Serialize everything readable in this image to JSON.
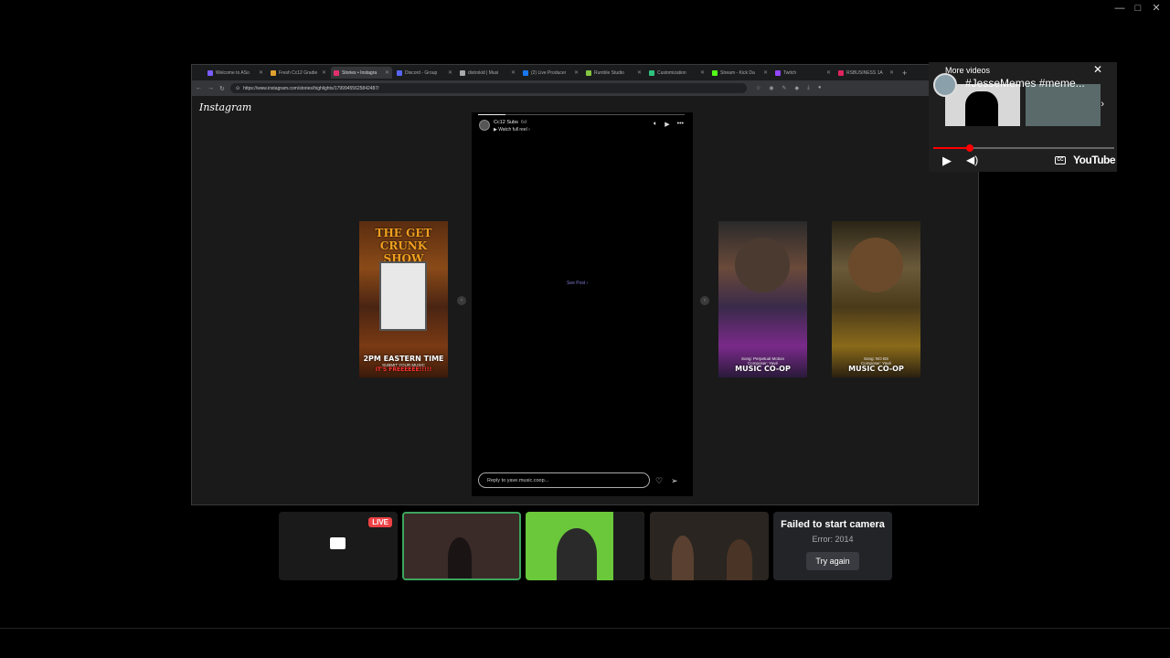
{
  "window_controls": [
    "—",
    "□",
    "✕"
  ],
  "browser": {
    "tabs": [
      {
        "label": "Welcome to ASo",
        "color": "#7b5cff"
      },
      {
        "label": "Fresh Cc12 Gradie",
        "color": "#e0a030"
      },
      {
        "label": "Stories • Instagra",
        "color": "#e1306c"
      },
      {
        "label": "Discord - Group",
        "color": "#5865f2"
      },
      {
        "label": "distrokid | Musi",
        "color": "#aaaaaa"
      },
      {
        "label": "(2) Live Producer",
        "color": "#1877f2"
      },
      {
        "label": "Rumble Studio",
        "color": "#85c742"
      },
      {
        "label": "Customization",
        "color": "#2ec27e"
      },
      {
        "label": "Stream - Kick Da",
        "color": "#53fc18"
      },
      {
        "label": "Twitch",
        "color": "#9146ff"
      },
      {
        "label": "RSBUSINESS 1A",
        "color": "#e0245e"
      }
    ],
    "url": "https://www.instagram.com/stories/highlights/17999455625842487/"
  },
  "instagram": {
    "logo": "Instagram",
    "story": {
      "username": "Cc12 Subs",
      "time": "6d",
      "watch_full": "Watch full reel",
      "see_post": "See Post",
      "reply_placeholder": "Reply to yave.music.coop..."
    },
    "thumbs": [
      {
        "top": "THE GET CRUNK SHOW",
        "big": "2PM EASTERN TIME",
        "sub": "SUBMIT YOUR MUSIC",
        "foot": "IT'S FREEEEEE!!!!!"
      },
      {
        "top": "",
        "big": "MUSIC CO-OP",
        "sub": "Song: Perpetual Motion",
        "foot": "Composer: Yavé"
      },
      {
        "top": "",
        "big": "MUSIC CO-OP",
        "sub": "Song: NO BS",
        "foot": "Composer: Yavé"
      }
    ]
  },
  "youtube": {
    "more_videos": "More videos",
    "video_title": "#JesseMemes #meme...",
    "logo": "YouTube",
    "progress_fraction": 0.2
  },
  "participants": {
    "live_label": "LIVE",
    "failed_title": "Failed to start camera",
    "failed_error": "Error: 2014",
    "retry_label": "Try again"
  }
}
